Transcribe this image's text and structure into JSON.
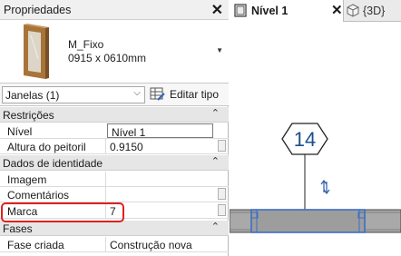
{
  "properties": {
    "title": "Propriedades",
    "type": {
      "family": "M_Fixo",
      "size": "0915 x 0610mm"
    },
    "instance_selector": "Janelas (1)",
    "edit_type_label": "Editar tipo",
    "groups": [
      {
        "label": "Restrições",
        "rows": [
          {
            "name": "Nível",
            "value": "Nível 1"
          },
          {
            "name": "Altura do peitoril",
            "value": "0.9150"
          }
        ]
      },
      {
        "label": "Dados de identidade",
        "rows": [
          {
            "name": "Imagem",
            "value": ""
          },
          {
            "name": "Comentários",
            "value": ""
          },
          {
            "name": "Marca",
            "value": "7"
          }
        ]
      },
      {
        "label": "Fases",
        "rows": [
          {
            "name": "Fase criada",
            "value": "Construção nova"
          }
        ]
      }
    ]
  },
  "view": {
    "tabs": [
      {
        "label": "Nível 1",
        "active": true
      },
      {
        "label": "{3D}",
        "active": false
      }
    ],
    "window_tag": "14"
  },
  "colors": {
    "highlight": "#e02020",
    "tag_blue": "#1b4f8c",
    "wall_fill": "#a9a9a9",
    "window_blue": "#3a6fc4"
  }
}
